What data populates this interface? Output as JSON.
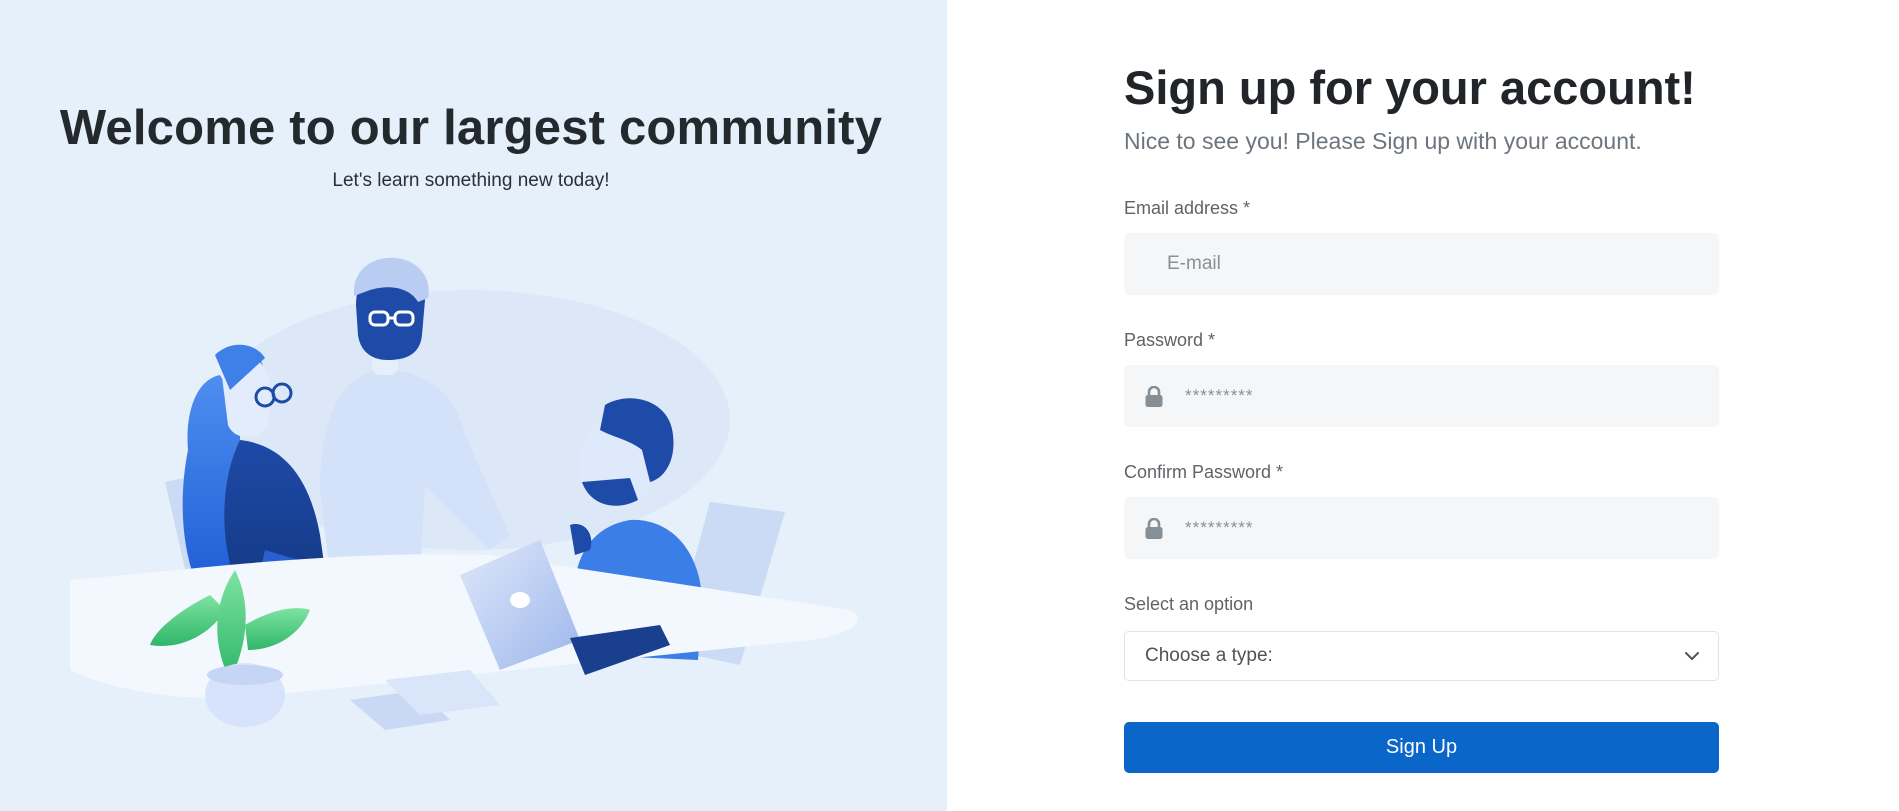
{
  "hero": {
    "title": "Welcome to our largest community",
    "subtitle": "Let's learn something new today!",
    "illustration_icon": "team-collaboration-illustration"
  },
  "form": {
    "title": "Sign up for your account!",
    "subtitle": "Nice to see you! Please Sign up with your account.",
    "email": {
      "label": "Email address *",
      "placeholder": "E-mail",
      "value": ""
    },
    "password": {
      "label": "Password *",
      "placeholder": "*********",
      "icon": "lock-icon",
      "value": ""
    },
    "confirm_password": {
      "label": "Confirm Password *",
      "placeholder": "*********",
      "icon": "lock-icon",
      "value": ""
    },
    "select": {
      "label": "Select an option",
      "selected": "Choose a type:",
      "icon": "chevron-down-icon"
    },
    "submit_label": "Sign Up"
  },
  "colors": {
    "hero_background": "#e6f0fa",
    "primary_button": "#0a66c8",
    "input_background": "#f4f6f8"
  }
}
